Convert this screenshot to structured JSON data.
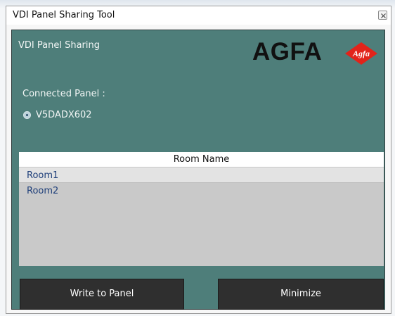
{
  "window": {
    "title": "VDI Panel Sharing Tool"
  },
  "panel": {
    "heading": "VDI Panel Sharing",
    "brand_word": "AGFA",
    "brand_logo_text": "Agfa",
    "brand_color": "#e2231a",
    "panel_color": "#4e7e7a"
  },
  "connection": {
    "label": "Connected Panel :",
    "panel_name": "V5DADX602",
    "selected": true
  },
  "rooms": {
    "header": "Room Name",
    "items": [
      "Room1",
      "Room2"
    ],
    "selected_index": 0
  },
  "buttons": {
    "write": "Write to Panel",
    "minimize": "Minimize"
  },
  "icons": {
    "close": "close-icon",
    "logo": "agfa-logo-icon",
    "radio": "radio-selected-icon"
  }
}
